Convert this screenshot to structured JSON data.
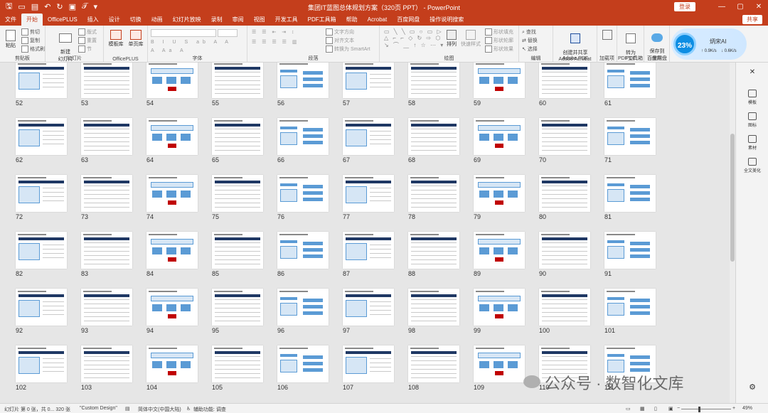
{
  "titlebar": {
    "title": "集团IT蓝图总体规划方案（320页 PPT） - PowerPoint",
    "signin": "登录",
    "window_controls": [
      "—",
      "▢",
      "✕"
    ]
  },
  "tabs": [
    "文件",
    "开始",
    "OfficePLUS",
    "插入",
    "设计",
    "切换",
    "动画",
    "幻灯片放映",
    "录制",
    "审阅",
    "视图",
    "开发工具",
    "PDF工具箱",
    "帮助",
    "Acrobat",
    "百度网盘",
    "操作说明搜索"
  ],
  "active_tab": "开始",
  "share_label": "共享",
  "ribbon": {
    "clipboard": {
      "paste": "粘贴",
      "cut": "剪切",
      "copy": "复制",
      "format_painter": "格式刷",
      "label": "剪贴板"
    },
    "slides": {
      "new_slide": "新建\n幻灯片",
      "layout": "版式",
      "reset": "重置",
      "section": "节",
      "label": "幻灯片"
    },
    "officeplus": {
      "template": "模板库",
      "single": "单页库",
      "label": "OfficePLUS"
    },
    "font": {
      "label": "字体"
    },
    "paragraph": {
      "text_direction": "文字方向",
      "align_text": "对齐文本",
      "smartart": "转换为 SmartArt",
      "label": "段落"
    },
    "drawing": {
      "arrange": "排列",
      "quick_styles": "快速样式",
      "shape_fill": "形状填充",
      "shape_outline": "形状轮廓",
      "shape_effects": "形状效果",
      "label": "绘图"
    },
    "editing": {
      "find": "查找",
      "replace": "替换",
      "select": "选择",
      "label": "编辑"
    },
    "acrobat": {
      "create_share": "创建并共享\nAdobe PDF",
      "label": "Adobe Acrobat"
    },
    "addins": {
      "label": "加载项"
    },
    "pdf": {
      "convert": "转为\nPDF",
      "label": "PDF工具箱"
    },
    "save": {
      "save_baidu": "保存到\n百度网盘",
      "label": "保存"
    },
    "ai": {
      "percent": "23%",
      "name": "炳宋AI",
      "up": "0.9K/s",
      "down": "0.6K/s"
    }
  },
  "slides": [
    52,
    53,
    54,
    55,
    56,
    57,
    58,
    59,
    60,
    61,
    62,
    63,
    64,
    65,
    66,
    67,
    68,
    69,
    70,
    71,
    72,
    73,
    74,
    75,
    76,
    77,
    78,
    79,
    80,
    81,
    82,
    83,
    84,
    85,
    86,
    87,
    88,
    89,
    90,
    91,
    92,
    93,
    94,
    95,
    96,
    97,
    98,
    99,
    100,
    101,
    102,
    103,
    104,
    105,
    106,
    107,
    108,
    109,
    110,
    111
  ],
  "right_pane": {
    "items": [
      "模板",
      "图标",
      "素材",
      "全文美化"
    ]
  },
  "statusbar": {
    "slide_info": "幻灯片 第 0 张，共 0... 320 张",
    "theme": "\"Custom Design\"",
    "language": "简体中文(中国大陆)",
    "accessibility": "辅助功能: 调查",
    "zoom": "49%"
  },
  "watermark": "公众号 · 数智化文库"
}
